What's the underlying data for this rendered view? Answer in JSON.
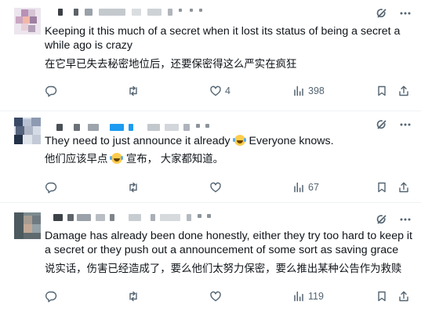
{
  "posts": [
    {
      "text_en": "Keeping it this much of a secret when it lost its status of being a secret a while ago is crazy",
      "text_zh": "在它早已失去秘密地位后，还要保密得这么严实在疯狂",
      "likes": "4",
      "views": "398"
    },
    {
      "text_en_before": "They need to just announce it already",
      "text_en_after": "Everyone knows.",
      "text_zh_before": "他们应该早点",
      "text_zh_after": "宣布，  大家都知道。",
      "views": "67"
    },
    {
      "text_en": "Damage has already been done honestly, either they try too hard to keep it a secret or they push out a announcement of some sort as saving grace",
      "text_zh": "说实话，伤害已经造成了，要么他们太努力保密，要么推出某种公告作为救赎",
      "views": "119"
    }
  ],
  "icons": {
    "reply": "reply-icon",
    "retweet": "retweet-icon",
    "like": "heart-icon",
    "views": "views-icon",
    "bookmark": "bookmark-icon",
    "share": "share-icon",
    "grok": "grok-icon",
    "more": "more-icon",
    "emoji": "tears-of-joy-emoji"
  },
  "colors": {
    "text": "#0f1419",
    "muted": "#536471",
    "divider": "#eff3f4",
    "redacted_accent": "#1d9bf0"
  }
}
